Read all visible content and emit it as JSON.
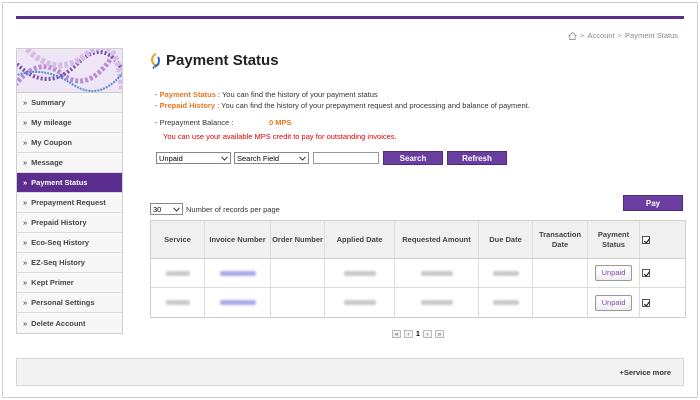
{
  "breadcrumb": {
    "sep": ">",
    "account": "Account",
    "current": "Payment Status"
  },
  "sidebar": {
    "items": [
      {
        "label": "Summary",
        "active": false
      },
      {
        "label": "My mileage",
        "active": false
      },
      {
        "label": "My Coupon",
        "active": false
      },
      {
        "label": "Message",
        "active": false
      },
      {
        "label": "Payment Status",
        "active": true
      },
      {
        "label": "Prepayment Request",
        "active": false
      },
      {
        "label": "Prepaid History",
        "active": false
      },
      {
        "label": "Eco-Seq History",
        "active": false
      },
      {
        "label": "EZ-Seq History",
        "active": false
      },
      {
        "label": "Kept Primer",
        "active": false
      },
      {
        "label": "Personal Settings",
        "active": false
      },
      {
        "label": "Delete Account",
        "active": false
      }
    ],
    "arrow": "»"
  },
  "page": {
    "title": "Payment Status"
  },
  "description": {
    "prefix": "- ",
    "line1_hl": "Payment Status",
    "line1_rest": " : You can find the history of your payment status",
    "line2_hl": "Prepaid History",
    "line2_rest": " : You can find the history of your prepayment request and processing and balance of payment."
  },
  "balance": {
    "label": "- Prepayment Balance :",
    "value": "0 MPS"
  },
  "notice": "You can use your available MPS credit to pay for outstanding invoices.",
  "filters": {
    "status_value": "Unpaid",
    "field_value": "Search Field",
    "search_text": "",
    "search_label": "Search",
    "refresh_label": "Refresh"
  },
  "records": {
    "value": "30",
    "label": "Number of records per page"
  },
  "pay_label": "Pay",
  "table": {
    "headers": [
      "Service",
      "Invoice Number",
      "Order Number",
      "Applied Date",
      "Requested Amount",
      "Due Date",
      "Transaction Date",
      "Payment Status"
    ],
    "rows": [
      {
        "status_label": "Unpaid",
        "checked": true
      },
      {
        "status_label": "Unpaid",
        "checked": true
      }
    ],
    "header_checked": true
  },
  "pager": {
    "first": "«",
    "prev": "‹",
    "page": "1",
    "next": "›",
    "last": "»"
  },
  "footer": {
    "service_more": "+Service more"
  },
  "colors": {
    "accent": "#5b2d8e",
    "highlight": "#e8761d",
    "notice": "#e00000"
  }
}
